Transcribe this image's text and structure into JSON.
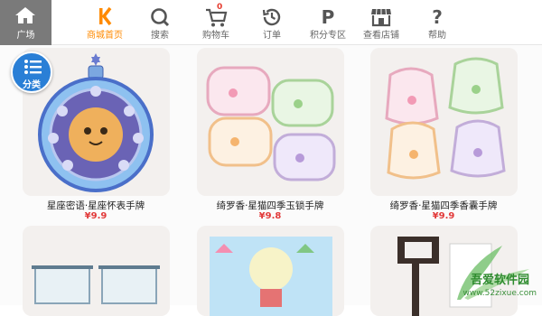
{
  "topbar": {
    "home_label": "广场",
    "nav": [
      {
        "label": "商城首页",
        "icon": "mall-home-icon",
        "active": true
      },
      {
        "label": "搜索",
        "icon": "search-icon"
      },
      {
        "label": "购物车",
        "icon": "cart-icon",
        "badge": "0"
      },
      {
        "label": "订单",
        "icon": "history-icon"
      },
      {
        "label": "积分专区",
        "icon": "points-icon",
        "glyph": "P"
      },
      {
        "label": "查看店铺",
        "icon": "shop-icon"
      },
      {
        "label": "帮助",
        "icon": "help-icon",
        "glyph": "?"
      }
    ]
  },
  "category_button": {
    "label": "分类"
  },
  "products": [
    {
      "name": "星座密语·星座怀表手牌",
      "price": "¥9.9"
    },
    {
      "name": "绮罗香·星猫四季玉锁手牌",
      "price": "¥9.8"
    },
    {
      "name": "绮罗香·星猫四季香囊手牌",
      "price": "¥9.9"
    }
  ],
  "watermark": {
    "title": "吾爱软件园",
    "url": "www.52zixue.com"
  },
  "colors": {
    "accent": "#ff8a00",
    "price": "#e23a3a",
    "category": "#2a7fd6"
  }
}
